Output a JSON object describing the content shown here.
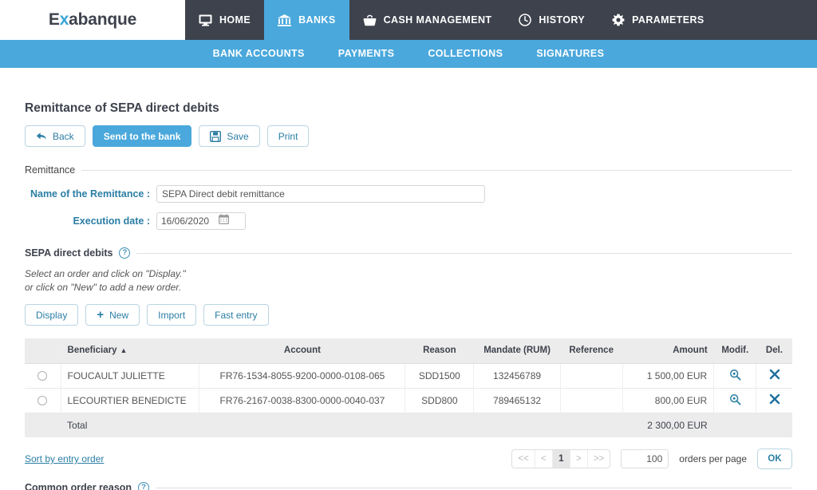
{
  "brand": {
    "name_prefix": "E",
    "name_accent": "x",
    "name_suffix": "abanque",
    "full_name": "Exabanque",
    "accent_color": "#3aa6d8",
    "navbar_color": "#3e424d",
    "subnav_color": "#4aa8dc"
  },
  "topnav": {
    "items": [
      {
        "label": "HOME",
        "icon": "monitor-icon",
        "active": false
      },
      {
        "label": "BANKS",
        "icon": "bank-icon",
        "active": true
      },
      {
        "label": "CASH MANAGEMENT",
        "icon": "purse-icon",
        "active": false
      },
      {
        "label": "HISTORY",
        "icon": "clock-icon",
        "active": false
      },
      {
        "label": "PARAMETERS",
        "icon": "gear-icon",
        "active": false
      }
    ]
  },
  "subnav": {
    "items": [
      {
        "label": "BANK ACCOUNTS",
        "active": false
      },
      {
        "label": "PAYMENTS",
        "active": false
      },
      {
        "label": "COLLECTIONS",
        "active": true
      },
      {
        "label": "SIGNATURES",
        "active": false
      }
    ]
  },
  "page": {
    "title": "Remittance of SEPA direct debits"
  },
  "toolbar": {
    "back_label": "Back",
    "send_label": "Send to the bank",
    "save_label": "Save",
    "print_label": "Print"
  },
  "remittance_section": {
    "heading": "Remittance",
    "name_label": "Name of the Remittance :",
    "name_value": "SEPA Direct debit remittance",
    "date_label": "Execution date :",
    "date_value": "16/06/2020"
  },
  "debits_section": {
    "heading": "SEPA direct debits",
    "help_glyph": "?",
    "instruction_line1": "Select an order and click on \"Display.\"",
    "instruction_line2": "or click on \"New\" to add a new order.",
    "buttons": {
      "display_label": "Display",
      "new_label": "New",
      "new_plus": "+",
      "import_label": "Import",
      "fast_entry_label": "Fast entry"
    }
  },
  "table": {
    "columns": [
      "Beneficiary",
      "Account",
      "Reason",
      "Mandate (RUM)",
      "Reference",
      "Amount",
      "Modif.",
      "Del."
    ],
    "sort_caret": "▲",
    "sorted_column": "Beneficiary",
    "rows": [
      {
        "beneficiary": "FOUCAULT JULIETTE",
        "account": "FR76-1534-8055-9200-0000-0108-065",
        "reason": "SDD1500",
        "mandate": "132456789",
        "reference": "",
        "amount": "1 500,00 EUR",
        "modif_icon": "magnifier-icon",
        "del_icon": "cross-icon"
      },
      {
        "beneficiary": "LECOURTIER BENEDICTE",
        "account": "FR76-2167-0038-8300-0000-0040-037",
        "reason": "SDD800",
        "mandate": "789465132",
        "reference": "",
        "amount": "800,00 EUR",
        "modif_icon": "magnifier-icon",
        "del_icon": "cross-icon"
      }
    ],
    "total_label": "Total",
    "total_amount": "2 300,00 EUR"
  },
  "footer": {
    "sort_link": "Sort by entry order",
    "pager": {
      "first": "<<",
      "prev": "<",
      "current": "1",
      "next": ">",
      "last": ">>"
    },
    "per_page_value": "100",
    "per_page_label": "orders per page",
    "ok_label": "OK"
  },
  "bottom_section": {
    "heading": "Common order reason",
    "help_glyph": "?"
  }
}
